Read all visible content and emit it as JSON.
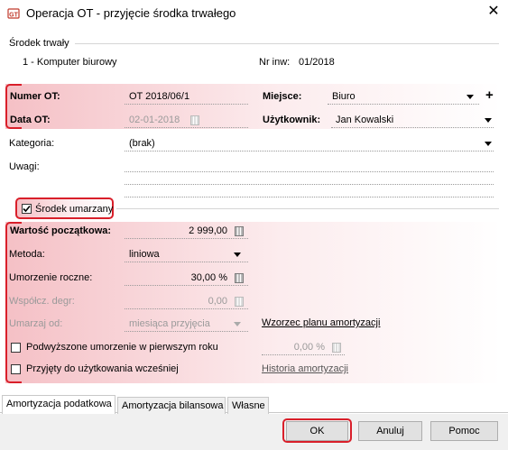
{
  "window": {
    "title": "Operacja OT - przyjęcie środka trwałego"
  },
  "asset": {
    "section_label": "Środek trwały",
    "name": "1 - Komputer biurowy",
    "inv_label": "Nr inw:",
    "inv_value": "01/2018"
  },
  "fields": {
    "numer_ot_label": "Numer OT:",
    "numer_ot_value": "OT 2018/06/1",
    "miejsce_label": "Miejsce:",
    "miejsce_value": "Biuro",
    "data_ot_label": "Data OT:",
    "data_ot_value": "02-01-2018",
    "uzytkownik_label": "Użytkownik:",
    "uzytkownik_value": "Jan Kowalski",
    "kategoria_label": "Kategoria:",
    "kategoria_value": "(brak)",
    "uwagi_label": "Uwagi:"
  },
  "depreciation": {
    "checkbox_label": "Środek umarzany",
    "checkbox_checked": true,
    "wartosc_label": "Wartość początkowa:",
    "wartosc_value": "2 999,00",
    "metoda_label": "Metoda:",
    "metoda_value": "liniowa",
    "umorzenie_label": "Umorzenie roczne:",
    "umorzenie_value": "30,00 %",
    "wspolcz_label": "Współcz. degr:",
    "wspolcz_value": "0,00",
    "umarzaj_label": "Umarzaj od:",
    "umarzaj_value": "miesiąca przyjęcia",
    "wzorzec_link": "Wzorzec planu amortyzacji",
    "podwyzszone_label": "Podwyższone umorzenie w pierwszym roku",
    "podwyzszone_value": "0,00 %",
    "przyjety_label": "Przyjęty do użytkowania wcześniej",
    "historia_link": "Historia amortyzacji"
  },
  "tabs": [
    {
      "label": "Amortyzacja podatkowa",
      "active": true
    },
    {
      "label": "Amortyzacja bilansowa",
      "active": false
    },
    {
      "label": "Własne",
      "active": false
    }
  ],
  "buttons": {
    "ok": "OK",
    "anuluj": "Anuluj",
    "pomoc": "Pomoc"
  },
  "colors": {
    "highlight_red": "#d91f2a"
  }
}
